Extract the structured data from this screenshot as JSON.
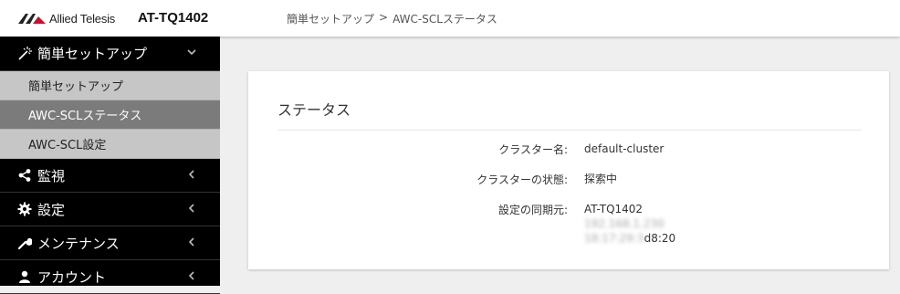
{
  "header": {
    "brand": "Allied Telesis",
    "model": "AT-TQ1402",
    "breadcrumb": [
      "簡単セットアップ",
      ">",
      "AWC-SCLステータス"
    ]
  },
  "sidebar": {
    "items": [
      {
        "label": "簡単セットアップ",
        "icon": "wand-icon",
        "chevron": "chevron-down-icon",
        "expanded": true,
        "children": [
          {
            "label": "簡単セットアップ",
            "active": false
          },
          {
            "label": "AWC-SCLステータス",
            "active": true
          },
          {
            "label": "AWC-SCL設定",
            "active": false
          }
        ]
      },
      {
        "label": "監視",
        "icon": "share-icon",
        "chevron": "chevron-left-icon"
      },
      {
        "label": "設定",
        "icon": "gear-icon",
        "chevron": "chevron-left-icon"
      },
      {
        "label": "メンテナンス",
        "icon": "wrench-icon",
        "chevron": "chevron-left-icon"
      },
      {
        "label": "アカウント",
        "icon": "user-icon",
        "chevron": "chevron-left-icon"
      }
    ]
  },
  "status": {
    "title": "ステータス",
    "rows": [
      {
        "label": "クラスター名:",
        "value": "default-cluster"
      },
      {
        "label": "クラスターの状態:",
        "value": "探索中"
      },
      {
        "label": "設定の同期元:",
        "lines": [
          "AT-TQ1402",
          "192.168.1.230",
          "18:17:29:3"
        ],
        "tail": "d8:20"
      }
    ]
  },
  "colors": {
    "sidebar_bg": "#000000",
    "submenu_bg": "#c6c6c6",
    "submenu_active_bg": "#7b7b7b",
    "page_bg": "#efefef"
  }
}
